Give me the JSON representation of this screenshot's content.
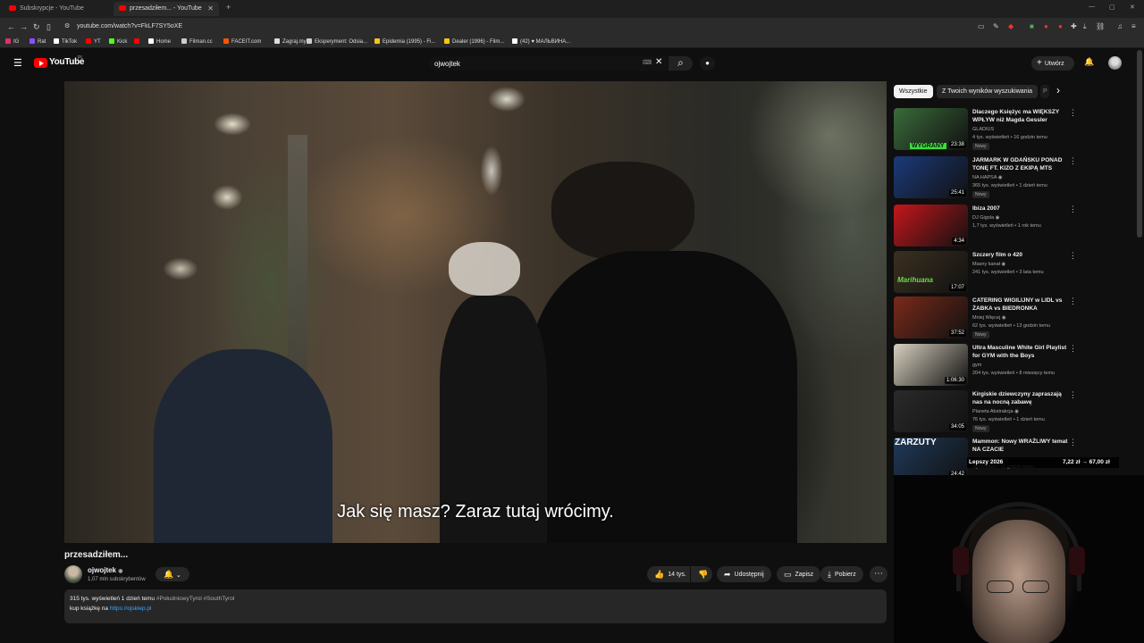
{
  "browser": {
    "tabs": [
      {
        "title": "Subskrypcje - YouTube",
        "active": false
      },
      {
        "title": "przesadziłem... - YouTube",
        "active": true
      }
    ],
    "new_tab_label": "+",
    "url": "youtube.com/watch?v=FkLF7SY5oXE",
    "bookmarks": [
      {
        "label": "IG",
        "icon": "instagram-icon",
        "color": "#e1306c"
      },
      {
        "label": "Rat",
        "icon": "bookmark-icon",
        "color": "#8a4fff"
      },
      {
        "label": "TikTok",
        "icon": "tiktok-icon",
        "color": "#ffffff"
      },
      {
        "label": "YT",
        "icon": "youtube-icon",
        "color": "#ff0000"
      },
      {
        "label": "Kick",
        "icon": "kick-icon",
        "color": "#53fc18"
      },
      {
        "label": "",
        "icon": "youtube-icon",
        "color": "#ff0000"
      },
      {
        "label": "Home",
        "icon": "x-icon",
        "color": "#ffffff"
      },
      {
        "label": "Filman.cc",
        "icon": "film-icon",
        "color": "#cccccc"
      },
      {
        "label": "FACEIT.com",
        "icon": "faceit-icon",
        "color": "#ff5500"
      },
      {
        "label": "Zagraj.my",
        "icon": "game-icon",
        "color": "#dddddd"
      },
      {
        "label": "Eksperyment: Odsia...",
        "icon": "film-icon",
        "color": "#cccccc"
      },
      {
        "label": "Epidemia (1995) - Fi...",
        "icon": "filmweb-icon",
        "color": "#f5c518"
      },
      {
        "label": "Dealer (1996) - Film...",
        "icon": "filmweb-icon",
        "color": "#f5c518"
      },
      {
        "label": "(42) ♥ МАЛЬВИНА...",
        "icon": "tiktok-icon",
        "color": "#ffffff"
      }
    ]
  },
  "youtube": {
    "logo_text": "YouTube",
    "country_code": "PL",
    "search_value": "ojwojtek",
    "create_label": "Utwórz"
  },
  "video": {
    "subtitle": "Jak się masz? Zaraz tutaj wrócimy.",
    "title": "przesadziłem...",
    "channel": "ojwojtek",
    "subscribers": "1,07 mln subskrybentów",
    "likes": "14 tys.",
    "share_label": "Udostępnij",
    "save_label": "Zapisz",
    "download_label": "Pobierz",
    "description": {
      "stats": "315 tys. wyświetleń  1 dzień temu",
      "tags": "#PołudniowyTyrol #SouthTyrol",
      "line2_prefix": "kup książkę na ",
      "link": "https://ojsklep.pl"
    }
  },
  "sidebar": {
    "chips": [
      "Wszystkie",
      "Z Twoich wyników wyszukiwania",
      "P"
    ],
    "recommendations": [
      {
        "title": "Dlaczego Księżyc ma WIĘKSZY WPŁYW niż Magda Gessler",
        "channel": "GLADIUS",
        "verified": false,
        "meta": "4 tys. wyświetleń • 16 godzin temu",
        "badge": "Nowy",
        "duration": "23:38",
        "thumb_text": "WYGRANY",
        "thumb_color": "#3a6b3a"
      },
      {
        "title": "JARMARK W GDAŃSKU PONAD TONĘ FT. KIZO Z EKIPĄ MTS",
        "channel": "NA HAPSA",
        "verified": true,
        "meta": "365 tys. wyświetleń • 1 dzień temu",
        "badge": "Nowy",
        "duration": "25:41",
        "thumb_text": "",
        "thumb_color": "#1b3a7a"
      },
      {
        "title": "Ibiza 2007",
        "channel": "DJ Gigola",
        "verified": true,
        "meta": "1,7 tys. wyświetleń • 1 rok temu",
        "badge": "",
        "duration": "4:34",
        "thumb_text": "",
        "thumb_color": "#c4161c"
      },
      {
        "title": "Szczery film o 420",
        "channel": "Masny kanał",
        "verified": true,
        "meta": "241 tys. wyświetleń • 3 lata temu",
        "badge": "",
        "duration": "17:07",
        "thumb_text": "Marihuana",
        "thumb_color": "#3b3020"
      },
      {
        "title": "CATERING WIGILIJNY w LIDL vs ŻABKA vs BIEDRONKA",
        "channel": "Mniej Więcej",
        "verified": true,
        "meta": "62 tys. wyświetleń • 13 godzin temu",
        "badge": "Nowy",
        "duration": "37:52",
        "thumb_text": "",
        "thumb_color": "#7a2a1a"
      },
      {
        "title": "Ultra Masculine White Girl Playlist for GYM with the Boys",
        "channel": "gym",
        "verified": false,
        "meta": "204 tys. wyświetleń • 8 miesięcy temu",
        "badge": "",
        "duration": "1:06:30",
        "thumb_text": "",
        "thumb_color": "#d8d0c0"
      },
      {
        "title": "Kirgiskie dziewczyny zapraszają nas na nocną zabawę",
        "channel": "Planeta Abstrakcja",
        "verified": true,
        "meta": "76 tys. wyświetleń • 1 dzień temu",
        "badge": "Nowy",
        "duration": "34:05",
        "thumb_text": "",
        "thumb_color": "#2a2a2a"
      },
      {
        "title": "Mammon: Nowy WRAŻLIWY temat NA CZACIE",
        "channel": "",
        "verified": false,
        "meta": "wyświetleń • 11 godzin temu",
        "badge": "",
        "duration": "24:42",
        "thumb_text": "ZARZUTY",
        "thumb_color": "#1f3a5a"
      }
    ],
    "price_overlay": {
      "left": "Lepszy 2026",
      "right": "7,22 zł → 67,00 zł"
    }
  },
  "icons": {
    "menu": "☰",
    "search": "⌕",
    "mic": "🎙",
    "bell": "🔔",
    "like": "👍",
    "dislike": "👎",
    "share": "➦",
    "save": "🔖",
    "download": "⤓",
    "more": "⋯",
    "kebab": "⋮",
    "plus": "+",
    "chevron_right": "›",
    "close": "✕"
  }
}
